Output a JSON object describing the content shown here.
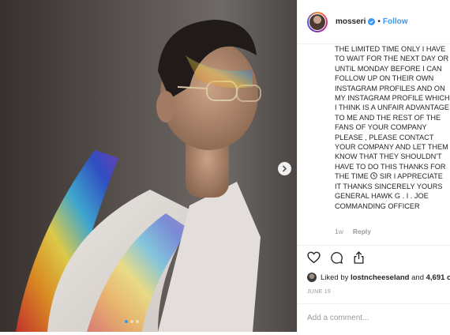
{
  "post": {
    "author": {
      "username": "mosseri",
      "verified": true,
      "separator": "•",
      "follow_label": "Follow"
    },
    "photo": {
      "slide_count": 3,
      "active_slide": 1,
      "next_icon": "chevron-right-icon"
    },
    "comment": {
      "text": "THE LIMITED TIME ONLY I HAVE TO WAIT FOR THE NEXT DAY OR UNTIL MONDAY BEFORE I CAN FOLLOW UP ON THEIR OWN INSTAGRAM PROFILES AND ON MY INSTAGRAM PROFILE WHICH I THINK IS A UNFAIR ADVANTAGE TO ME AND THE REST OF THE FANS OF YOUR COMPANY PLEASE , PLEASE CONTACT YOUR COMPANY AND LET THEM KNOW THAT THEY SHOULDN'T HAVE TO DO THIS THANKS FOR THE TIME",
      "text_after_icon": "SIR I APPRECIATE IT THANKS SINCERELY YOURS GENERAL HAWK G . I . JOE COMMANDING OFFICER",
      "inline_icon": "clock-icon",
      "age": "1w",
      "reply_label": "Reply"
    },
    "actions": {
      "like_icon": "heart-icon",
      "comment_icon": "comment-icon",
      "share_icon": "share-icon"
    },
    "likes": {
      "prefix": "Liked by",
      "first_user": "lostncheeseland",
      "conjunction": "and",
      "others": "4,691 o"
    },
    "date": "JUNE 19",
    "add_comment": {
      "placeholder": "Add a comment..."
    }
  },
  "colors": {
    "link_blue": "#3897f0",
    "text": "#262626",
    "muted": "#999999",
    "border": "#efefef"
  }
}
